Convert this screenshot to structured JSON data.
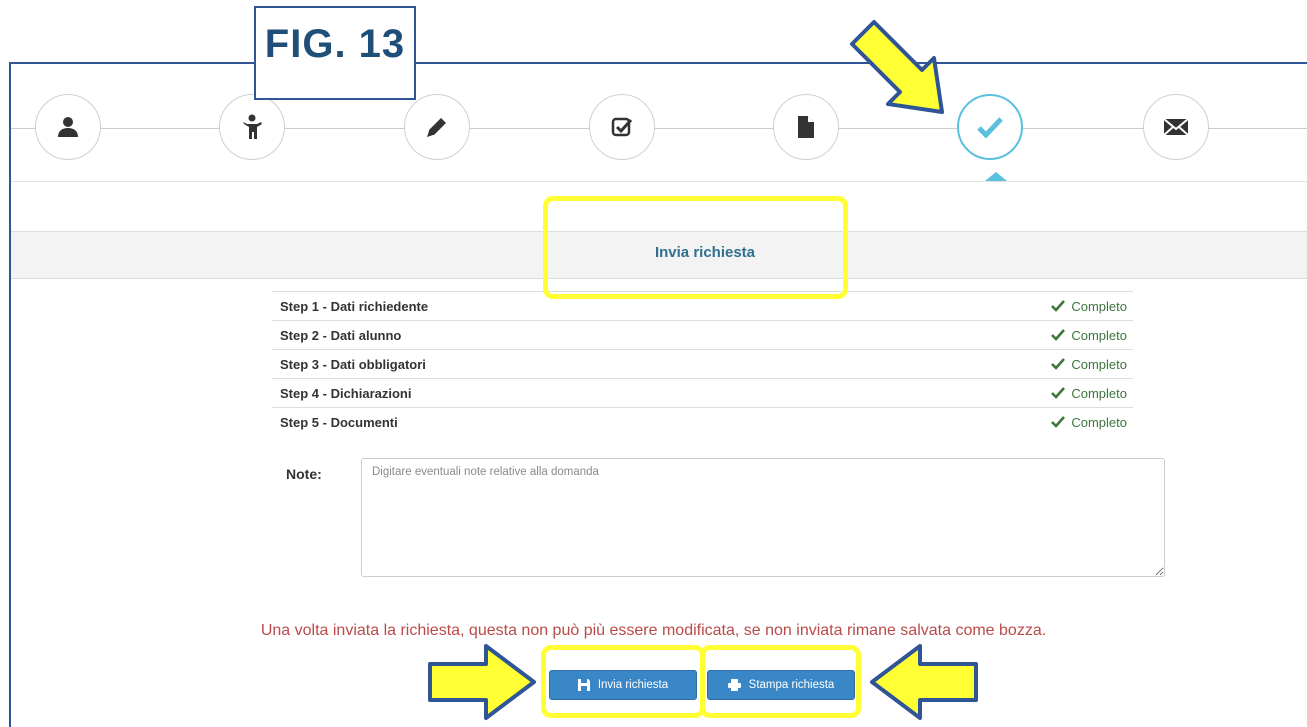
{
  "figure_label": "FIG. 13",
  "wizard": {
    "steps": [
      {
        "icon": "user-icon",
        "state": "done"
      },
      {
        "icon": "child-icon",
        "state": "done"
      },
      {
        "icon": "pencil-icon",
        "state": "done"
      },
      {
        "icon": "checkbox-icon",
        "state": "done"
      },
      {
        "icon": "document-icon",
        "state": "done"
      },
      {
        "icon": "check-icon",
        "state": "active"
      },
      {
        "icon": "envelope-icon",
        "state": "pending"
      }
    ]
  },
  "section_title": "Invia richiesta",
  "summary": [
    {
      "label": "Step 1 - Dati richiedente",
      "status": "Completo"
    },
    {
      "label": "Step 2 - Dati alunno",
      "status": "Completo"
    },
    {
      "label": "Step 3 - Dati obbligatori",
      "status": "Completo"
    },
    {
      "label": "Step 4 - Dichiarazioni",
      "status": "Completo"
    },
    {
      "label": "Step 5 - Documenti",
      "status": "Completo"
    }
  ],
  "notes": {
    "label": "Note:",
    "placeholder": "Digitare eventuali note relative alla domanda",
    "value": ""
  },
  "warning": "Una volta inviata la richiesta, questa non può più essere modificata, se non inviata rimane salvata come bozza.",
  "buttons": {
    "send_label": "Invia richiesta",
    "print_label": "Stampa richiesta"
  },
  "colors": {
    "accent": "#5bc0de",
    "primary_button": "#3a87c8",
    "success": "#3c763d",
    "warning": "#b94a48",
    "highlight": "#ffff33",
    "annotation_border": "#2f5597"
  }
}
